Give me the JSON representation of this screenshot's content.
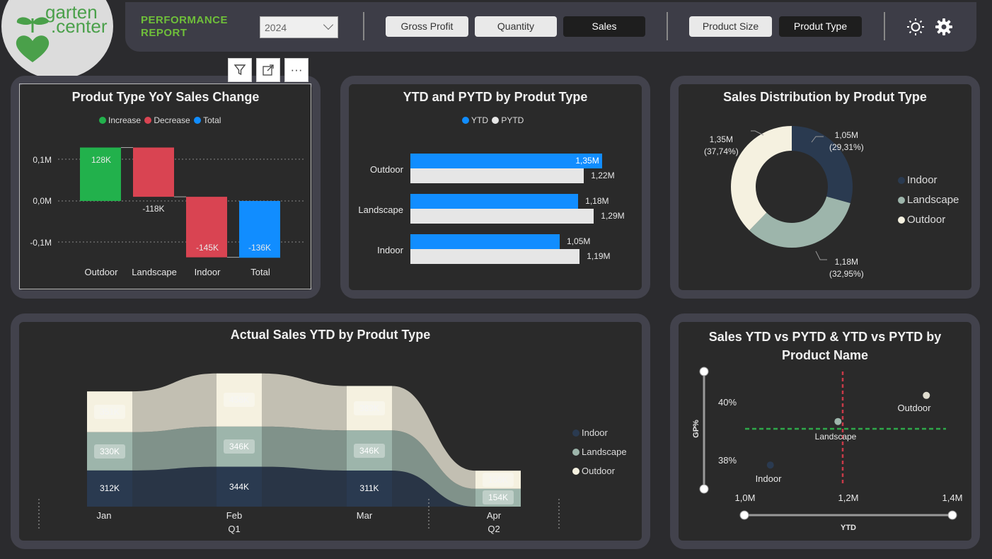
{
  "header": {
    "logo_line1": "garten",
    "logo_line2": ".center",
    "report_title_line1": "PERFORMANCE",
    "report_title_line2": "REPORT",
    "year": "2024",
    "metric_buttons": [
      "Gross Profit",
      "Quantity",
      "Sales"
    ],
    "active_metric": "Sales",
    "dimension_buttons": [
      "Product Size",
      "Produt Type"
    ],
    "active_dimension": "Produt Type",
    "icons": [
      "sun-icon",
      "gear-icon"
    ]
  },
  "visual_toolbar": [
    "filter-icon",
    "focus-mode-icon",
    "more-options-icon"
  ],
  "colors": {
    "increase": "#22b14c",
    "decrease": "#d94452",
    "total": "#118dff",
    "indoor": "#2a3a50",
    "landscape": "#9db5ab",
    "outdoor": "#f5f1e0"
  },
  "panels": {
    "waterfall": {
      "title": "Produt Type YoY Sales Change",
      "legend": [
        "Increase",
        "Decrease",
        "Total"
      ],
      "ticks": [
        "0,1M",
        "0,0M",
        "-0,1M"
      ],
      "bar_labels": [
        "128K",
        "-118K",
        "-145K",
        "-136K"
      ],
      "categories": [
        "Outdoor",
        "Landscape",
        "Indoor",
        "Total"
      ]
    },
    "ytd_bars": {
      "title": "YTD and PYTD by Produt Type",
      "legend": [
        "YTD",
        "PYTD"
      ],
      "categories": [
        "Outdoor",
        "Landscape",
        "Indoor"
      ],
      "ytd_labels": [
        "1,35M",
        "1,18M",
        "1,05M"
      ],
      "pytd_labels": [
        "1,22M",
        "1,29M",
        "1,19M"
      ]
    },
    "donut": {
      "title": "Sales Distribution by Produt Type",
      "legend": [
        "Indoor",
        "Landscape",
        "Outdoor"
      ],
      "labels": [
        {
          "value": "1,05M",
          "pct": "(29,31%)"
        },
        {
          "value": "1,18M",
          "pct": "(32,95%)"
        },
        {
          "value": "1,35M",
          "pct": "(37,74%)"
        }
      ]
    },
    "ribbon": {
      "title": "Actual Sales YTD by Produt Type",
      "legend": [
        "Indoor",
        "Landscape",
        "Outdoor"
      ],
      "months": [
        "Jan",
        "Feb",
        "Mar",
        "Apr"
      ],
      "quarters": [
        "Q1",
        "Q2"
      ],
      "outdoor_labels": [
        "351K",
        "458K",
        "383K",
        "156K"
      ],
      "landscape_labels": [
        "330K",
        "346K",
        "346K",
        "154K"
      ],
      "indoor_labels": [
        "312K",
        "344K",
        "311K"
      ]
    },
    "scatter": {
      "title_line1": "Sales YTD vs PYTD & YTD vs PYTD by",
      "title_line2": "Product Name",
      "y_axis_label": "GP%",
      "x_axis_label": "YTD",
      "y_ticks": [
        "40%",
        "38%"
      ],
      "x_ticks": [
        "1,0M",
        "1,2M",
        "1,4M"
      ],
      "point_labels": [
        "Outdoor",
        "Landscape",
        "Indoor"
      ]
    }
  },
  "chart_data": [
    {
      "type": "bar",
      "title": "Produt Type YoY Sales Change",
      "categories": [
        "Outdoor",
        "Landscape",
        "Indoor",
        "Total"
      ],
      "values": [
        128,
        -118,
        -145,
        -136
      ],
      "ylim": [
        -0.14,
        0.14
      ],
      "legend": "top"
    },
    {
      "type": "bar",
      "title": "YTD and PYTD by Produt Type",
      "categories": [
        "Outdoor",
        "Landscape",
        "Indoor"
      ],
      "series": [
        {
          "name": "YTD",
          "values": [
            1.35,
            1.18,
            1.05
          ]
        },
        {
          "name": "PYTD",
          "values": [
            1.22,
            1.29,
            1.19
          ]
        }
      ],
      "legend": "top"
    },
    {
      "type": "pie",
      "title": "Sales Distribution by Produt Type",
      "categories": [
        "Indoor",
        "Landscape",
        "Outdoor"
      ],
      "values": [
        1.05,
        1.18,
        1.35
      ],
      "percent": [
        29.31,
        32.95,
        37.74
      ],
      "legend": "right"
    },
    {
      "type": "area",
      "title": "Actual Sales YTD by Produt Type",
      "categories": [
        "Jan",
        "Feb",
        "Mar",
        "Apr"
      ],
      "series": [
        {
          "name": "Indoor",
          "values": [
            312,
            344,
            311,
            0
          ]
        },
        {
          "name": "Landscape",
          "values": [
            330,
            346,
            346,
            154
          ]
        },
        {
          "name": "Outdoor",
          "values": [
            351,
            458,
            383,
            156
          ]
        }
      ],
      "legend": "right"
    },
    {
      "type": "scatter",
      "title": "Sales YTD vs PYTD & YTD vs PYTD by Product Name",
      "xlabel": "YTD",
      "ylabel": "GP%",
      "xlim": [
        1.0,
        1.4
      ],
      "points": [
        {
          "name": "Outdoor",
          "x": 1.35,
          "y": 40.2
        },
        {
          "name": "Landscape",
          "x": 1.18,
          "y": 39.3
        },
        {
          "name": "Indoor",
          "x": 1.05,
          "y": 37.8
        }
      ]
    }
  ]
}
